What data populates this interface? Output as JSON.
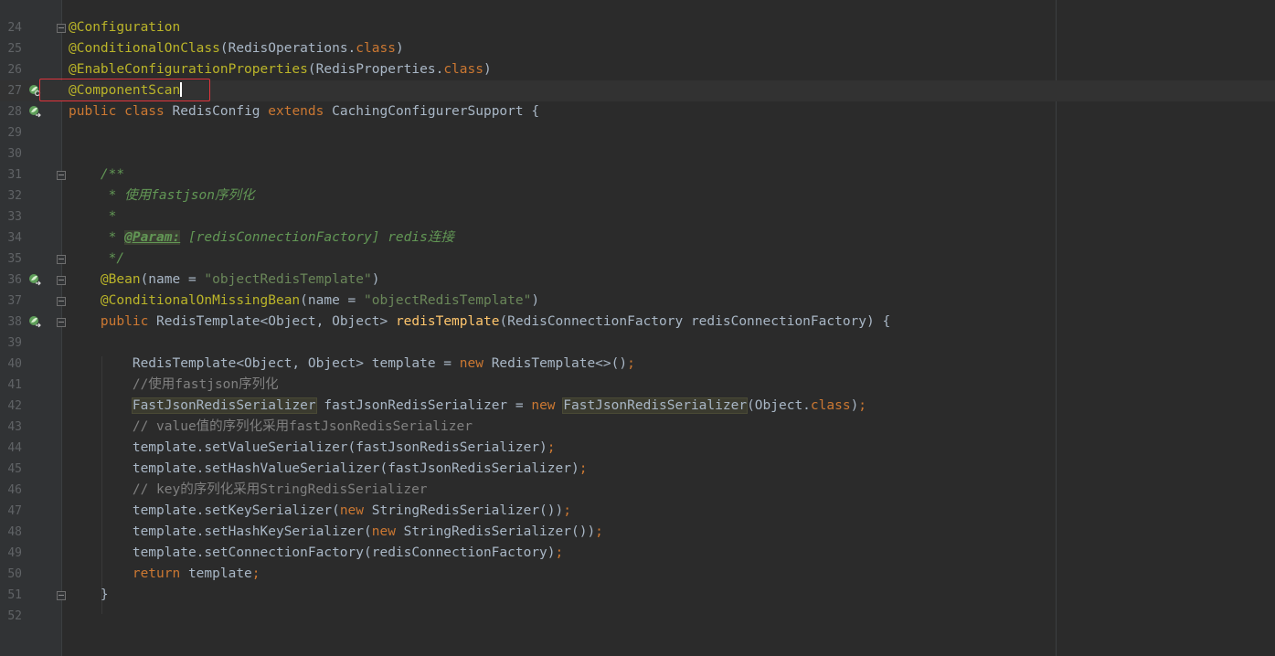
{
  "editor": {
    "lines": [
      {
        "n": "24",
        "tokens": [
          {
            "t": "@Configuration",
            "c": "ann"
          }
        ]
      },
      {
        "n": "25",
        "tokens": [
          {
            "t": "@ConditionalOnClass",
            "c": "ann"
          },
          {
            "t": "(RedisOperations.",
            "c": ""
          },
          {
            "t": "class",
            "c": "kw"
          },
          {
            "t": ")",
            "c": ""
          }
        ]
      },
      {
        "n": "26",
        "tokens": [
          {
            "t": "@EnableConfigurationProperties",
            "c": "ann"
          },
          {
            "t": "(RedisProperties.",
            "c": ""
          },
          {
            "t": "class",
            "c": "kw"
          },
          {
            "t": ")",
            "c": ""
          }
        ]
      },
      {
        "n": "27",
        "tokens": [
          {
            "t": "@ComponentScan",
            "c": "ann"
          }
        ]
      },
      {
        "n": "28",
        "tokens": [
          {
            "t": "public class ",
            "c": "kw"
          },
          {
            "t": "RedisConfig ",
            "c": ""
          },
          {
            "t": "extends ",
            "c": "kw"
          },
          {
            "t": "CachingConfigurerSupport {",
            "c": ""
          }
        ]
      },
      {
        "n": "29",
        "tokens": []
      },
      {
        "n": "30",
        "tokens": []
      },
      {
        "n": "31",
        "tokens": [
          {
            "t": "    /**",
            "c": "doc"
          }
        ]
      },
      {
        "n": "32",
        "tokens": [
          {
            "t": "     * 使用fastjson序列化",
            "c": "doc"
          }
        ]
      },
      {
        "n": "33",
        "tokens": [
          {
            "t": "     *",
            "c": "doc"
          }
        ]
      },
      {
        "n": "34",
        "tokens": [
          {
            "t": "     * ",
            "c": "doc"
          },
          {
            "t": "@Param:",
            "c": "doctag"
          },
          {
            "t": " [redisConnectionFactory] redis连接",
            "c": "doc"
          }
        ]
      },
      {
        "n": "35",
        "tokens": [
          {
            "t": "     */",
            "c": "doc"
          }
        ]
      },
      {
        "n": "36",
        "tokens": [
          {
            "t": "    @Bean",
            "c": "ann"
          },
          {
            "t": "(name = ",
            "c": ""
          },
          {
            "t": "\"objectRedisTemplate\"",
            "c": "str"
          },
          {
            "t": ")",
            "c": ""
          }
        ]
      },
      {
        "n": "37",
        "tokens": [
          {
            "t": "    @ConditionalOnMissingBean",
            "c": "ann"
          },
          {
            "t": "(name = ",
            "c": ""
          },
          {
            "t": "\"objectRedisTemplate\"",
            "c": "str"
          },
          {
            "t": ")",
            "c": ""
          }
        ]
      },
      {
        "n": "38",
        "tokens": [
          {
            "t": "    public ",
            "c": "kw"
          },
          {
            "t": "RedisTemplate<Object, Object> ",
            "c": ""
          },
          {
            "t": "redisTemplate",
            "c": "fn"
          },
          {
            "t": "(RedisConnectionFactory redisConnectionFactory) {",
            "c": ""
          }
        ]
      },
      {
        "n": "39",
        "tokens": []
      },
      {
        "n": "40",
        "tokens": [
          {
            "t": "        RedisTemplate<Object, Object> template = ",
            "c": ""
          },
          {
            "t": "new ",
            "c": "kw"
          },
          {
            "t": "RedisTemplate<>()",
            "c": ""
          },
          {
            "t": ";",
            "c": "kw"
          }
        ]
      },
      {
        "n": "41",
        "tokens": [
          {
            "t": "        //使用fastjson序列化",
            "c": "cmt"
          }
        ]
      },
      {
        "n": "42",
        "tokens": [
          {
            "t": "        ",
            "c": ""
          },
          {
            "t": "FastJsonRedisSerializer",
            "c": "hl"
          },
          {
            "t": " fastJsonRedisSerializer = ",
            "c": ""
          },
          {
            "t": "new ",
            "c": "kw"
          },
          {
            "t": "FastJsonRedisSerializer",
            "c": "hl"
          },
          {
            "t": "(Object.",
            "c": ""
          },
          {
            "t": "class",
            "c": "kw"
          },
          {
            "t": ")",
            "c": ""
          },
          {
            "t": ";",
            "c": "kw"
          }
        ]
      },
      {
        "n": "43",
        "tokens": [
          {
            "t": "        // value值的序列化采用fastJsonRedisSerializer",
            "c": "cmt"
          }
        ]
      },
      {
        "n": "44",
        "tokens": [
          {
            "t": "        template.setValueSerializer(fastJsonRedisSerializer)",
            "c": ""
          },
          {
            "t": ";",
            "c": "kw"
          }
        ]
      },
      {
        "n": "45",
        "tokens": [
          {
            "t": "        template.setHashValueSerializer(fastJsonRedisSerializer)",
            "c": ""
          },
          {
            "t": ";",
            "c": "kw"
          }
        ]
      },
      {
        "n": "46",
        "tokens": [
          {
            "t": "        // key的序列化采用StringRedisSerializer",
            "c": "cmt"
          }
        ]
      },
      {
        "n": "47",
        "tokens": [
          {
            "t": "        template.setKeySerializer(",
            "c": ""
          },
          {
            "t": "new ",
            "c": "kw"
          },
          {
            "t": "StringRedisSerializer())",
            "c": ""
          },
          {
            "t": ";",
            "c": "kw"
          }
        ]
      },
      {
        "n": "48",
        "tokens": [
          {
            "t": "        template.setHashKeySerializer(",
            "c": ""
          },
          {
            "t": "new ",
            "c": "kw"
          },
          {
            "t": "StringRedisSerializer())",
            "c": ""
          },
          {
            "t": ";",
            "c": "kw"
          }
        ]
      },
      {
        "n": "49",
        "tokens": [
          {
            "t": "        template.setConnectionFactory(redisConnectionFactory)",
            "c": ""
          },
          {
            "t": ";",
            "c": "kw"
          }
        ]
      },
      {
        "n": "50",
        "tokens": [
          {
            "t": "        return ",
            "c": "kw"
          },
          {
            "t": "template",
            "c": ""
          },
          {
            "t": ";",
            "c": "kw"
          }
        ]
      },
      {
        "n": "51",
        "tokens": [
          {
            "t": "    }",
            "c": ""
          }
        ]
      },
      {
        "n": "52",
        "tokens": []
      }
    ],
    "gutter_icons": [
      {
        "line": "27",
        "icon": "spring-scan-icon"
      },
      {
        "line": "28",
        "icon": "spring-bean-icon"
      },
      {
        "line": "36",
        "icon": "spring-bean-navigate-icon"
      },
      {
        "line": "38",
        "icon": "spring-bean-navigate-icon"
      }
    ],
    "fold_markers": [
      "24",
      "31",
      "35",
      "36",
      "37",
      "38",
      "51"
    ],
    "caret_line": "27",
    "selection_box_line": "27",
    "colors": {
      "background": "#2b2b2b",
      "gutter": "#313335",
      "annotation": "#bbb529",
      "keyword": "#cc7832",
      "string": "#6a8759",
      "comment": "#808080",
      "doc_comment": "#629755",
      "method": "#ffc66d",
      "selection_box": "#e0343c"
    }
  }
}
